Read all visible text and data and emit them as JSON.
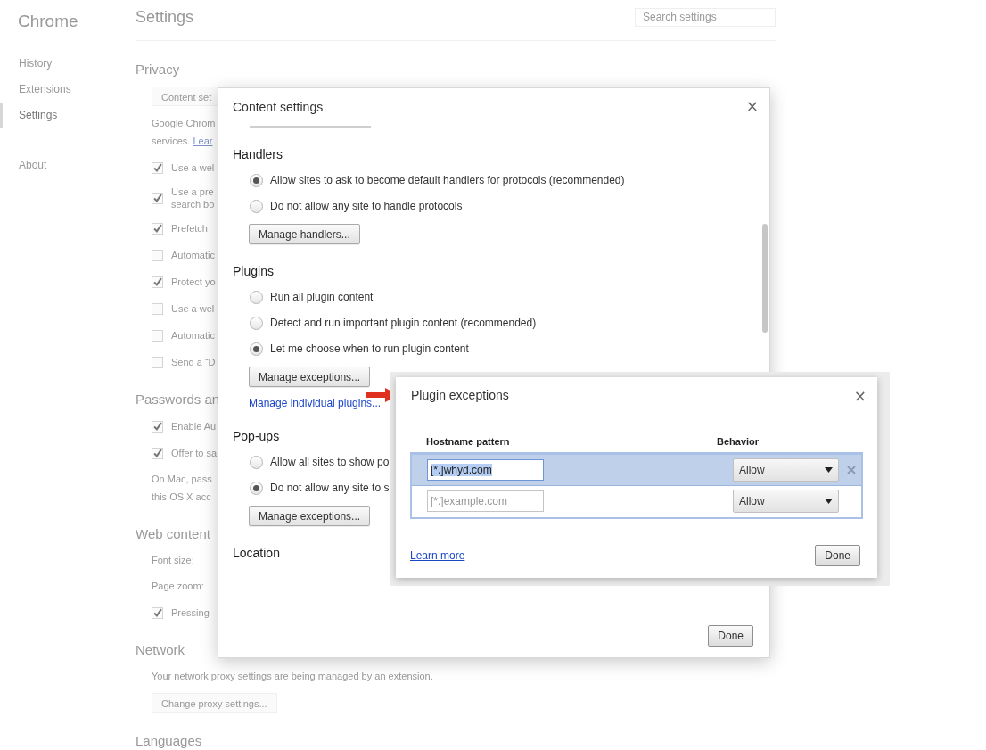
{
  "sidebar": {
    "title": "Chrome",
    "items": [
      {
        "label": "History",
        "selected": false
      },
      {
        "label": "Extensions",
        "selected": false
      },
      {
        "label": "Settings",
        "selected": true
      }
    ],
    "footer_items": [
      {
        "label": "About",
        "selected": false
      }
    ]
  },
  "page": {
    "title": "Settings",
    "search": {
      "placeholder": "Search settings"
    },
    "sections": [
      {
        "title": "Privacy",
        "items": [
          {
            "kind": "button",
            "label": "Content set"
          },
          {
            "kind": "text",
            "text": "Google Chrom"
          },
          {
            "kind": "link_text",
            "text": "services.",
            "link": "Lear"
          },
          {
            "kind": "checkbox",
            "label": "Use a wel",
            "checked": true
          },
          {
            "kind": "checkbox",
            "label": "Use a pre\nsearch bo",
            "checked": true
          },
          {
            "kind": "checkbox",
            "label": "Prefetch",
            "checked": true
          },
          {
            "kind": "checkbox",
            "label": "Automatic",
            "checked": false
          },
          {
            "kind": "checkbox",
            "label": "Protect yo",
            "checked": true
          },
          {
            "kind": "checkbox",
            "label": "Use a wel",
            "checked": false
          },
          {
            "kind": "checkbox",
            "label": "Automatic",
            "checked": false
          },
          {
            "kind": "checkbox",
            "label": "Send a “D",
            "checked": false
          }
        ]
      },
      {
        "title": "Passwords an",
        "items": [
          {
            "kind": "checkbox",
            "label": "Enable Au",
            "checked": true
          },
          {
            "kind": "checkbox",
            "label": "Offer to sa",
            "checked": true
          },
          {
            "kind": "text",
            "text": "On Mac, pass\nthis OS X acc"
          }
        ]
      },
      {
        "title": "Web content",
        "items": [
          {
            "kind": "text",
            "text": "Font size:"
          },
          {
            "kind": "text",
            "text": "Page zoom:"
          },
          {
            "kind": "checkbox",
            "label": "Pressing",
            "checked": true
          }
        ]
      },
      {
        "title": "Network",
        "items": [
          {
            "kind": "text",
            "text": "Your network proxy settings are being managed by an extension."
          },
          {
            "kind": "button",
            "label": "Change proxy settings..."
          }
        ]
      },
      {
        "title": "Languages"
      }
    ]
  },
  "content_dialog": {
    "title": "Content settings",
    "close": "×",
    "sections": [
      {
        "title": "Handlers",
        "items": [
          {
            "kind": "radio",
            "label": "Allow sites to ask to become default handlers for protocols (recommended)",
            "selected": true
          },
          {
            "kind": "radio",
            "label": "Do not allow any site to handle protocols",
            "selected": false
          },
          {
            "kind": "button",
            "label": "Manage handlers..."
          }
        ]
      },
      {
        "title": "Plugins",
        "items": [
          {
            "kind": "radio",
            "label": "Run all plugin content",
            "selected": false
          },
          {
            "kind": "radio",
            "label": "Detect and run important plugin content (recommended)",
            "selected": false
          },
          {
            "kind": "radio",
            "label": "Let me choose when to run plugin content",
            "selected": true
          },
          {
            "kind": "button",
            "label": "Manage exceptions..."
          },
          {
            "kind": "link",
            "label": "Manage individual plugins..."
          }
        ]
      },
      {
        "title": "Pop-ups",
        "items": [
          {
            "kind": "radio",
            "label": "Allow all sites to show po",
            "selected": false
          },
          {
            "kind": "radio",
            "label": "Do not allow any site to s",
            "selected": true
          },
          {
            "kind": "button",
            "label": "Manage exceptions..."
          }
        ]
      },
      {
        "title": "Location"
      }
    ],
    "done": "Done"
  },
  "plugin_dialog": {
    "title": "Plugin exceptions",
    "close": "×",
    "columns": [
      "Hostname pattern",
      "Behavior"
    ],
    "rows": [
      {
        "value": "[*.]whyd.com",
        "behavior": "Allow",
        "selected": true
      },
      {
        "placeholder": "[*.]example.com",
        "behavior": "Allow",
        "selected": false
      }
    ],
    "learn_more": "Learn more",
    "done": "Done"
  }
}
